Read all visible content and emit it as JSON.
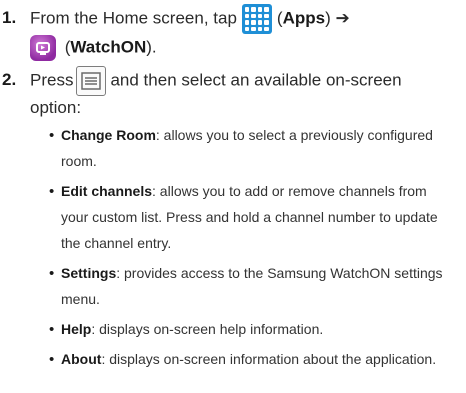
{
  "step1": {
    "number": "1.",
    "text_before": "From the Home screen, tap",
    "apps_label": "Apps",
    "arrow": "➔",
    "watchon_label": "WatchON",
    "icons": [
      "apps-grid-icon",
      "watchon-icon"
    ]
  },
  "step2": {
    "number": "2.",
    "text_press": "Press",
    "text_after": "and then select an available on-screen",
    "text_line2": "option:",
    "icons": [
      "menu-key-icon"
    ]
  },
  "options": [
    {
      "label": "Change Room",
      "desc_line1": ": allows you to select a previously configured",
      "desc_line2": "room.",
      "desc_line3": ""
    },
    {
      "label": "Edit channels",
      "desc_line1": ": allows you to add or remove channels from",
      "desc_line2": "your custom list. Press and hold a channel number to update",
      "desc_line3": "the channel entry."
    },
    {
      "label": "Settings",
      "desc_line1": ": provides access to the Samsung WatchON settings",
      "desc_line2": "menu.",
      "desc_line3": ""
    },
    {
      "label": "Help",
      "desc_line1": ": displays on-screen help information.",
      "desc_line2": "",
      "desc_line3": ""
    },
    {
      "label": "About",
      "desc_line1": ": displays on-screen information about the application.",
      "desc_line2": "",
      "desc_line3": ""
    }
  ],
  "colors": {
    "apps_icon": "#1f8fd6",
    "watchon_icon": "#9b33aa"
  }
}
